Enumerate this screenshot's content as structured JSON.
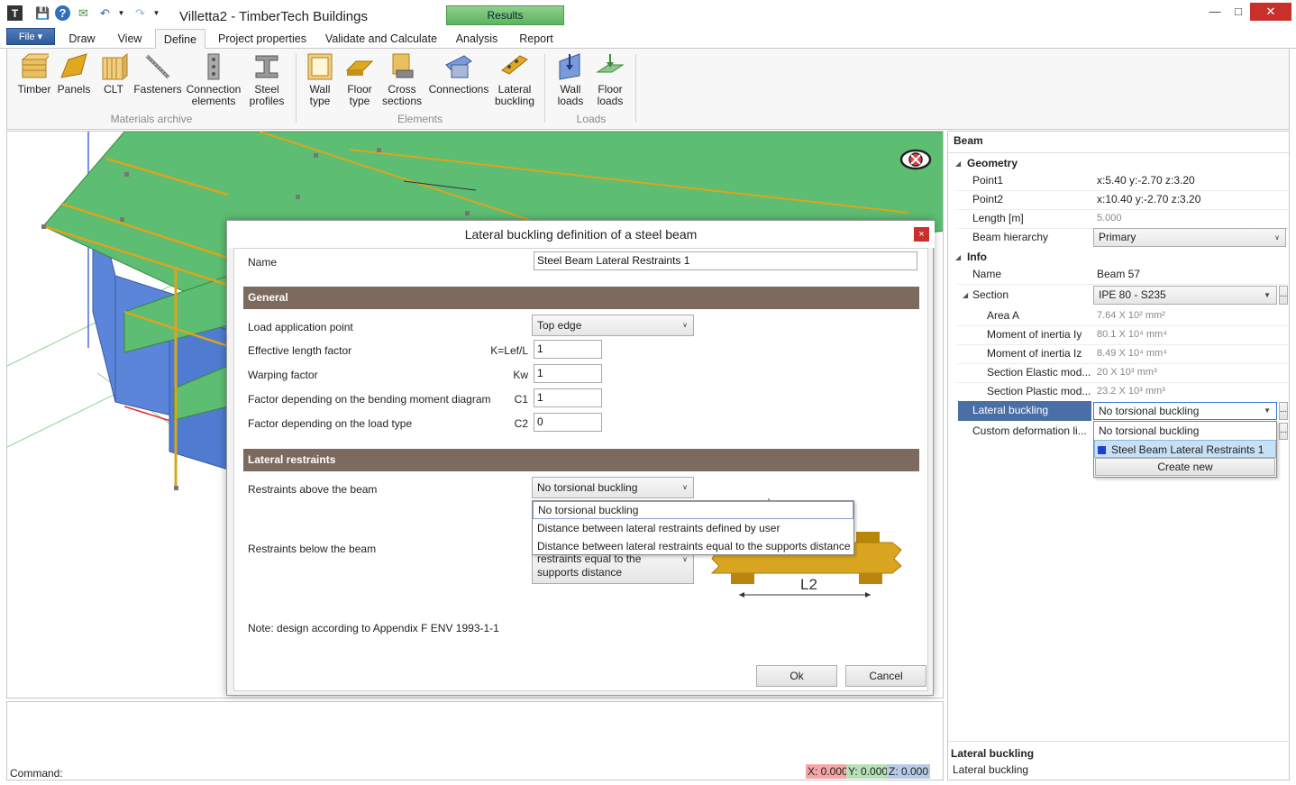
{
  "app": {
    "title": "Villetta2 - TimberTech Buildings",
    "results_tab": "Results"
  },
  "menu": {
    "file": "File",
    "tabs": [
      "Draw",
      "View",
      "Define",
      "Project properties",
      "Validate and Calculate",
      "Analysis",
      "Report"
    ]
  },
  "ribbon": {
    "materials": {
      "group_label": "Materials archive",
      "items": [
        "Timber",
        "Panels",
        "CLT",
        "Fasteners",
        "Connection elements",
        "Steel profiles"
      ]
    },
    "elements": {
      "group_label": "Elements",
      "items": [
        "Wall type",
        "Floor type",
        "Cross sections",
        "Connections",
        "Lateral buckling"
      ]
    },
    "loads": {
      "group_label": "Loads",
      "items": [
        "Wall loads",
        "Floor loads"
      ]
    }
  },
  "dialog": {
    "title": "Lateral buckling definition of a steel beam",
    "close": "×",
    "name_label": "Name",
    "name_value": "Steel Beam Lateral Restraints 1",
    "general_header": "General",
    "load_point_label": "Load application point",
    "load_point_value": "Top edge",
    "eff_length_label": "Effective length factor",
    "eff_length_symbol": "K=Lef/L",
    "eff_length_value": "1",
    "warping_label": "Warping factor",
    "warping_symbol": "Kw",
    "warping_value": "1",
    "c1_label": "Factor depending on the bending moment diagram",
    "c1_symbol": "C1",
    "c1_value": "1",
    "c2_label": "Factor depending on the load type",
    "c2_symbol": "C2",
    "c2_value": "0",
    "restraints_header": "Lateral restraints",
    "above_label": "Restraints above the beam",
    "above_value": "No torsional buckling",
    "above_options": [
      "No torsional buckling",
      "Distance between lateral restraints defined by user",
      "Distance between lateral restraints equal to the supports distance"
    ],
    "below_label": "Restraints below the beam",
    "below_value_line1": "restraints equal to the",
    "below_value_line2": "supports distance",
    "figure_label": "L2",
    "note": "Note: design according to Appendix F ENV 1993-1-1",
    "ok": "Ok",
    "cancel": "Cancel"
  },
  "panel": {
    "title": "Beam",
    "geometry_header": "Geometry",
    "point1_label": "Point1",
    "point1_value": "x:5.40 y:-2.70 z:3.20",
    "point2_label": "Point2",
    "point2_value": "x:10.40 y:-2.70 z:3.20",
    "length_label": "Length [m]",
    "length_value": "5.000",
    "hierarchy_label": "Beam hierarchy",
    "hierarchy_value": "Primary",
    "info_header": "Info",
    "name_label": "Name",
    "name_value": "Beam 57",
    "section_label": "Section",
    "section_value": "IPE 80 - S235",
    "area_label": "Area A",
    "area_value": "7.64 X 10² mm²",
    "iy_label": "Moment of inertia Iy",
    "iy_value": "80.1 X 10⁴ mm⁴",
    "iz_label": "Moment of inertia Iz",
    "iz_value": "8.49 X 10⁴ mm⁴",
    "elastic_label": "Section Elastic mod...",
    "elastic_value": "20 X 10³ mm³",
    "plastic_label": "Section Plastic mod...",
    "plastic_value": "23.2 X 10³ mm³",
    "lateral_label": "Lateral buckling",
    "lateral_value": "No torsional buckling",
    "lateral_options": [
      "No torsional buckling",
      "Steel Beam Lateral Restraints 1",
      "Create new"
    ],
    "custom_label": "Custom deformation li...",
    "help_title": "Lateral buckling",
    "help_text": "Lateral buckling"
  },
  "command": {
    "label": "Command:",
    "x": "X: 0.000",
    "y": "Y: 0.000",
    "z": "Z: 0.000"
  },
  "colors": {
    "section_header": "#7d6a5e",
    "selected_row": "#4a6ea6",
    "results_tab": "#6cbf6c",
    "roof": "#5dbd72",
    "wall": "#5a85d8",
    "timber": "#d9a520"
  }
}
